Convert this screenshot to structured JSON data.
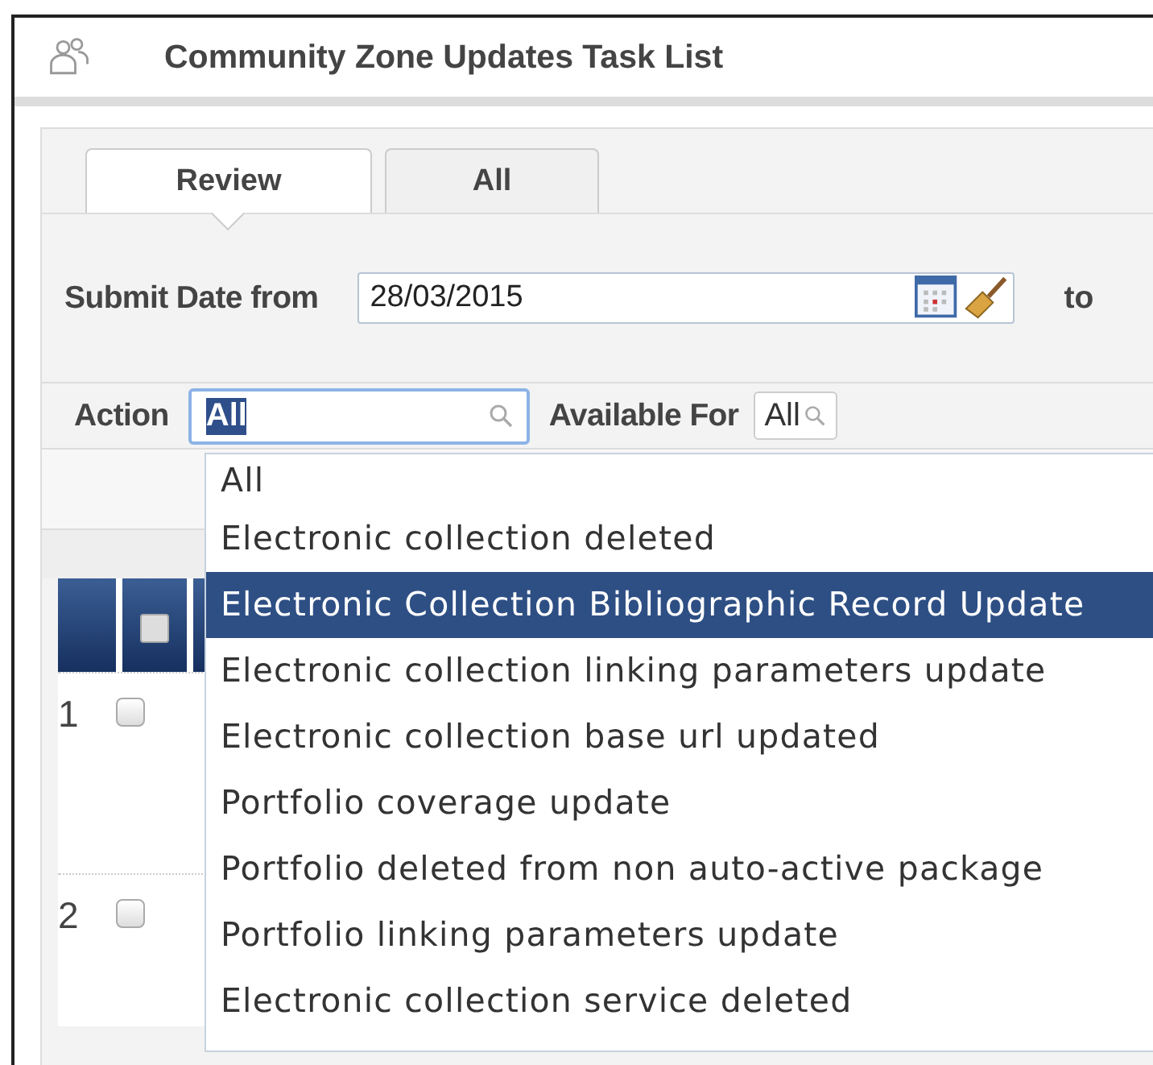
{
  "window": {
    "title": "Community Zone Updates Task List"
  },
  "tabs": [
    {
      "label": "Review",
      "selected": true
    },
    {
      "label": "All",
      "selected": false
    }
  ],
  "filters": {
    "submit_date_label": "Submit Date from",
    "submit_date_value": "28/03/2015",
    "to_label": "to",
    "action_label": "Action",
    "action_value": "All",
    "available_for_label": "Available For",
    "available_for_value": "All"
  },
  "table": {
    "header_checkbox_checked": false,
    "rows": [
      {
        "number": "1",
        "checked": false
      },
      {
        "number": "2",
        "checked": false
      }
    ]
  },
  "action_dropdown": {
    "options": [
      {
        "label": "All",
        "selected": false
      },
      {
        "label": "Electronic collection deleted",
        "selected": false
      },
      {
        "label": "Electronic Collection Bibliographic Record Update",
        "selected": true
      },
      {
        "label": "Electronic collection linking parameters update",
        "selected": false
      },
      {
        "label": "Electronic collection base url updated",
        "selected": false
      },
      {
        "label": "Portfolio coverage update",
        "selected": false
      },
      {
        "label": "Portfolio deleted from non auto-active package",
        "selected": false
      },
      {
        "label": "Portfolio linking parameters update",
        "selected": false
      },
      {
        "label": "Electronic collection service deleted",
        "selected": false
      }
    ]
  }
}
